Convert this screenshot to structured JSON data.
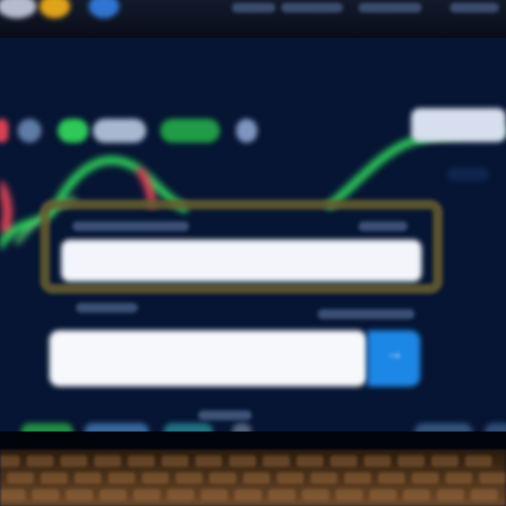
{
  "window": {
    "title": ""
  },
  "header": {
    "tabs": [
      {
        "label": ""
      },
      {
        "label": ""
      },
      {
        "label": ""
      },
      {
        "label": ""
      }
    ]
  },
  "trade_form": {
    "symbol_label": "",
    "symbol_value": "",
    "amount_label": "",
    "amount_placeholder": "",
    "action_label": "",
    "icons": {
      "action": "arrow-right-icon"
    }
  },
  "status_bar": {
    "items": [
      {
        "label": ""
      },
      {
        "label": ""
      },
      {
        "label": ""
      },
      {
        "label": ""
      },
      {
        "label": ""
      },
      {
        "label": ""
      }
    ]
  },
  "colors": {
    "background": "#061533",
    "accent": "#1d87e5",
    "positive": "#2dca59",
    "negative": "#d94155",
    "highlight": "#675d2d"
  }
}
